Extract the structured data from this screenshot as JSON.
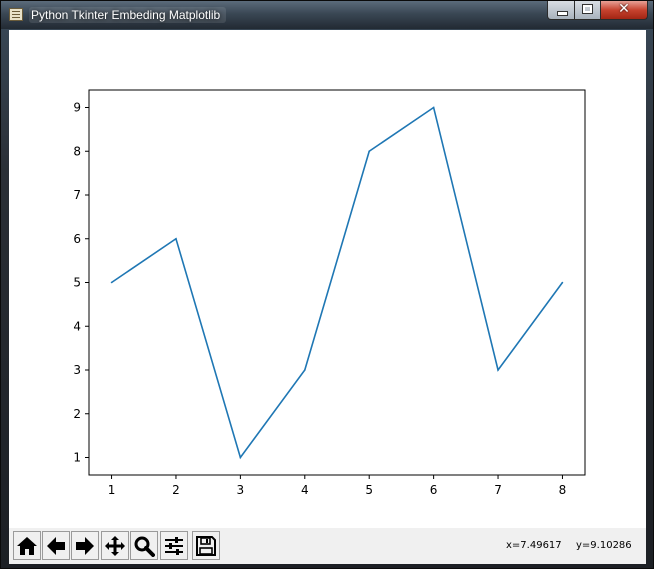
{
  "window": {
    "title": "Python Tkinter Embeding Matplotlib",
    "close_glyph": "✕"
  },
  "toolbar": {
    "buttons": [
      {
        "icon": "home-icon",
        "label": "Home"
      },
      {
        "icon": "back-arrow-icon",
        "label": "Back"
      },
      {
        "icon": "forward-arrow-icon",
        "label": "Forward"
      },
      {
        "icon": "pan-icon",
        "label": "Pan"
      },
      {
        "icon": "zoom-icon",
        "label": "Zoom"
      },
      {
        "icon": "subplots-icon",
        "label": "Subplots"
      },
      {
        "icon": "save-icon",
        "label": "Save"
      }
    ],
    "coord_x": "x=7.49617",
    "coord_y": "y=9.10286"
  },
  "chart_data": {
    "type": "line",
    "x": [
      1,
      2,
      3,
      4,
      5,
      6,
      7,
      8
    ],
    "series": [
      {
        "values": [
          5,
          6,
          1,
          3,
          8,
          9,
          3,
          5
        ],
        "color": "#1f77b4"
      }
    ],
    "title": "",
    "xlabel": "",
    "ylabel": "",
    "xlim": [
      0.65,
      8.35
    ],
    "ylim": [
      0.6,
      9.4
    ],
    "xticks": [
      1,
      2,
      3,
      4,
      5,
      6,
      7,
      8
    ],
    "yticks": [
      1,
      2,
      3,
      4,
      5,
      6,
      7,
      8,
      9
    ],
    "grid": false
  }
}
